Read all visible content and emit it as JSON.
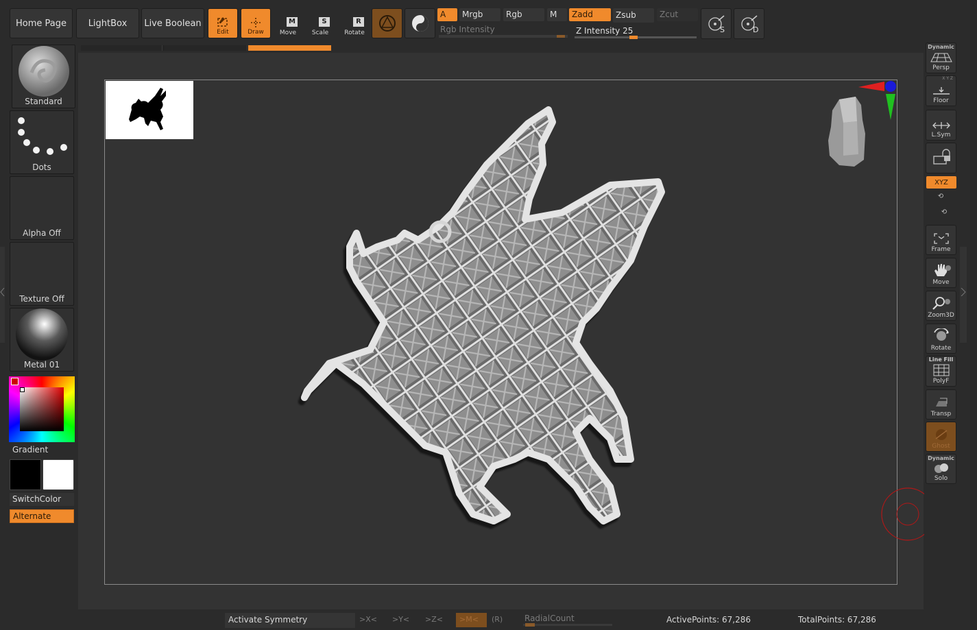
{
  "top_nav": {
    "home": "Home Page",
    "lightbox": "LightBox",
    "live_boolean": "Live Boolean"
  },
  "tools": {
    "edit": "Edit",
    "draw": "Draw",
    "move": "Move",
    "scale": "Scale",
    "rotate": "Rotate",
    "move_key": "M",
    "scale_key": "S",
    "rotate_key": "R"
  },
  "color_modes": {
    "a": "A",
    "mrgb": "Mrgb",
    "rgb": "Rgb",
    "m": "M",
    "zadd": "Zadd",
    "zsub": "Zsub",
    "zcut": "Zcut"
  },
  "sliders": {
    "rgb_intensity_label": "Rgb Intensity",
    "z_intensity_label": "Z Intensity",
    "z_intensity_value": "25"
  },
  "edge_buttons": {
    "s_label": "S",
    "d_label": "D"
  },
  "left_panel": {
    "brush": "Standard",
    "stroke": "Dots",
    "alpha": "Alpha Off",
    "texture": "Texture Off",
    "material": "Metal 01",
    "gradient": "Gradient",
    "switch_color": "SwitchColor",
    "alternate": "Alternate"
  },
  "right_shelf": {
    "dynamic": "Dynamic",
    "persp": "Persp",
    "floor": "Floor",
    "floor_axes": "X Y Z",
    "lsym": "L.Sym",
    "xyz": "XYZ",
    "frame": "Frame",
    "move": "Move",
    "zoom3d": "Zoom3D",
    "rotate": "Rotate",
    "line_fill": "Line Fill",
    "polyf": "PolyF",
    "transp": "Transp",
    "ghost": "Ghost",
    "dynamic2": "Dynamic",
    "solo": "Solo"
  },
  "bottom_bar": {
    "activate_symmetry": "Activate Symmetry",
    "x": ">X<",
    "y": ">Y<",
    "z": ">Z<",
    "m": ">M<",
    "r": "(R)",
    "radial_count": "RadialCount",
    "active_points": "ActivePoints: 67,286",
    "total_points": "TotalPoints: 67,286"
  },
  "colors": {
    "accent": "#f08a2c",
    "background": "#2b2b2b",
    "canvas": "#333333"
  }
}
